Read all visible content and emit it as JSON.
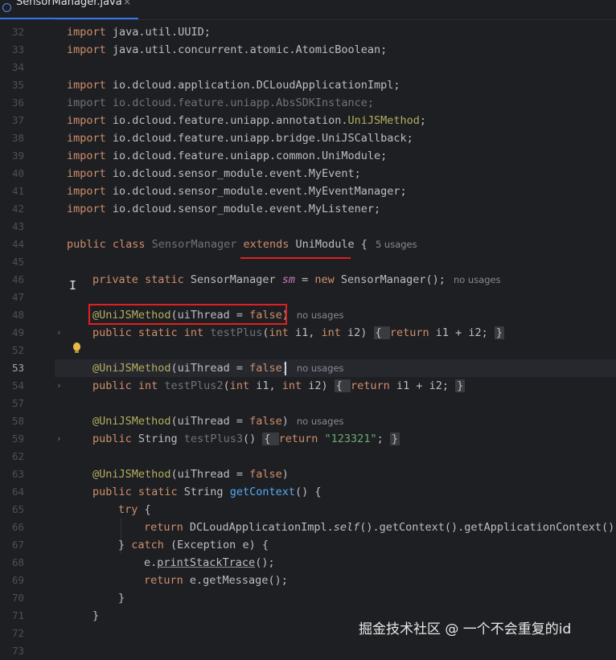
{
  "tab": {
    "label": "SensorManager.java",
    "close": "×"
  },
  "line_numbers": [
    "32",
    "33",
    "34",
    "35",
    "36",
    "37",
    "38",
    "39",
    "40",
    "41",
    "42",
    "43",
    "44",
    "45",
    "46",
    "47",
    "48",
    "49",
    "52",
    "53",
    "54",
    "57",
    "58",
    "59",
    "62",
    "63",
    "64",
    "65",
    "66",
    "67",
    "68",
    "69",
    "70",
    "71",
    "72",
    "73"
  ],
  "code": {
    "imp1": [
      "import",
      " java.util.UUID;"
    ],
    "imp2": [
      "import",
      " java.util.concurrent.atomic.AtomicBoolean;"
    ],
    "imp3": [
      "import",
      " io.dcloud.application.DCLoudApplicationImpl;"
    ],
    "imp4": "import io.dcloud.feature.uniapp.AbsSDKInstance;",
    "imp5": [
      "import",
      " io.dcloud.feature.uniapp.annotation.",
      "UniJSMethod",
      ";"
    ],
    "imp6": [
      "import",
      " io.dcloud.feature.uniapp.bridge.UniJSCallback;"
    ],
    "imp7": [
      "import",
      " io.dcloud.feature.uniapp.common.UniModule;"
    ],
    "imp8": [
      "import",
      " io.dcloud.sensor_module.event.MyEvent;"
    ],
    "imp9": [
      "import",
      " io.dcloud.sensor_module.event.MyEventManager;"
    ],
    "imp10": [
      "import",
      " io.dcloud.sensor_module.event.MyListener;"
    ],
    "class_decl": [
      "public class ",
      "SensorManager",
      " ",
      "extends",
      " UniModule {"
    ],
    "field": [
      "private static ",
      "SensorManager ",
      "sm",
      " = ",
      "new",
      " SensorManager();"
    ],
    "ann": "@UniJSMethod",
    "ann_args": [
      "(uiThread = ",
      "false",
      ")"
    ],
    "m1": [
      "public static int ",
      "testPlus",
      "(",
      "int",
      " i1, ",
      "int",
      " i2) ",
      "{ ",
      "return",
      " i1 + i2; ",
      "}"
    ],
    "m2": [
      "public int ",
      "testPlus2",
      "(",
      "int",
      " i1, ",
      "int",
      " i2) ",
      "{ ",
      "return",
      " i1 + i2; ",
      "}"
    ],
    "m3": [
      "public ",
      "String ",
      "testPlus3",
      "() ",
      "{ ",
      "return",
      " ",
      "\"123321\"",
      "; ",
      "}"
    ],
    "m4": [
      "public static ",
      "String ",
      "getContext",
      "() {"
    ],
    "try": [
      "try",
      " {"
    ],
    "ret1": [
      "return",
      " DCLoudApplicationImpl.",
      "self",
      "().getContext().getApplicationContext().g"
    ],
    "catch": [
      "} ",
      "catch",
      " (Exception e) {"
    ],
    "print": [
      "e.",
      "printStackTrace",
      "();"
    ],
    "ret2": [
      "return",
      " e.getMessage();"
    ],
    "close_inner": "}",
    "close_outer": "}"
  },
  "inlay_hints": {
    "usages5": "5 usages",
    "no_usages": "no usages"
  },
  "watermark": "掘金技术社区 @ 一个不会重复的id"
}
